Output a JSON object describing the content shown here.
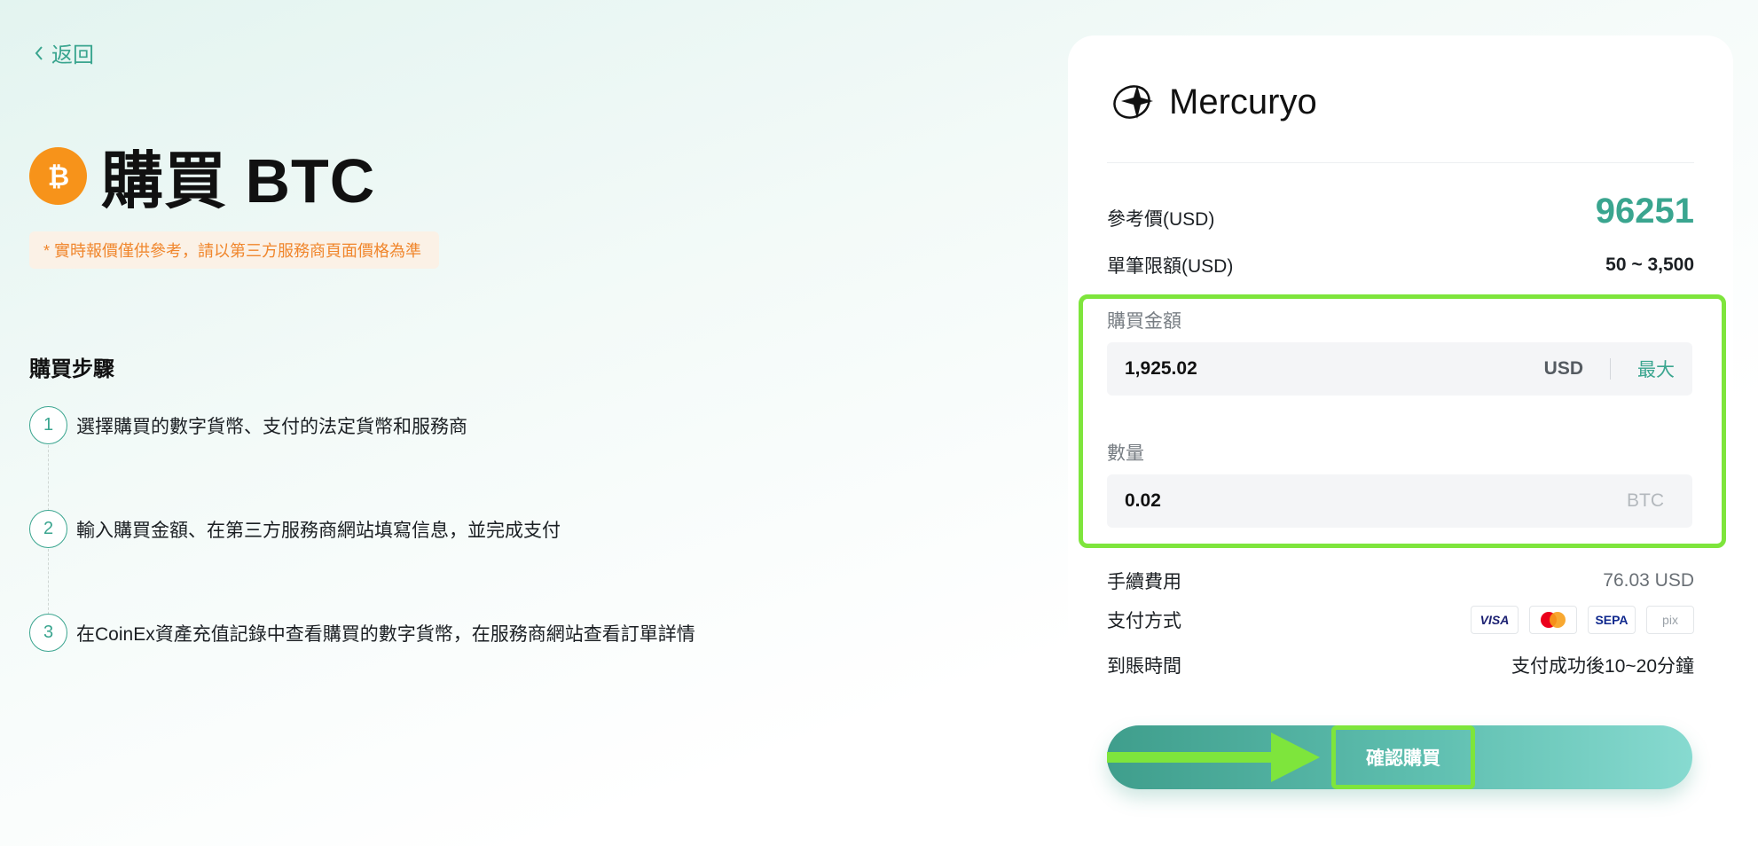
{
  "nav": {
    "back_label": "返回"
  },
  "header": {
    "title": "購買 BTC",
    "coin_icon": "bitcoin-icon"
  },
  "notice": "* 實時報價僅供參考，請以第三方服務商頁面價格為準",
  "steps": {
    "title": "購買步驟",
    "items": [
      {
        "num": "1",
        "text": "選擇購買的數字貨幣、支付的法定貨幣和服務商"
      },
      {
        "num": "2",
        "text": "輸入購買金額、在第三方服務商網站填寫信息，並完成支付"
      },
      {
        "num": "3",
        "text": "在CoinEx資產充值記錄中查看購買的數字貨幣，在服務商網站查看訂單詳情"
      }
    ]
  },
  "provider": {
    "name": "Mercuryo",
    "ref_price_label": "參考價(USD)",
    "ref_price": "96251",
    "limit_label": "單筆限額(USD)",
    "limit": "50 ~ 3,500",
    "amount_label": "購買金額",
    "amount_value": "1,925.02",
    "amount_unit": "USD",
    "max_label": "最大",
    "qty_label": "數量",
    "qty_value": "0.02",
    "qty_unit": "BTC",
    "fee_label": "手續費用",
    "fee": "76.03 USD",
    "payment_label": "支付方式",
    "payment_methods": [
      "VISA",
      "mastercard",
      "SEPA",
      "pix"
    ],
    "arrival_label": "到賬時間",
    "arrival": "支付成功後10~20分鐘",
    "confirm_label": "確認購買"
  },
  "colors": {
    "accent": "#3aa58f",
    "highlight": "#7ee53c",
    "notice": "#f0862c",
    "btc": "#f7931a"
  }
}
